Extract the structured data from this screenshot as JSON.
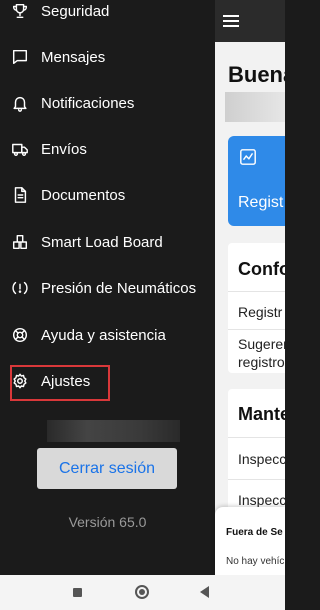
{
  "drawer": {
    "items": [
      {
        "label": "Seguridad",
        "icon": "trophy-icon"
      },
      {
        "label": "Mensajes",
        "icon": "message-icon"
      },
      {
        "label": "Notificaciones",
        "icon": "bell-icon"
      },
      {
        "label": "Envíos",
        "icon": "truck-icon"
      },
      {
        "label": "Documentos",
        "icon": "document-icon"
      },
      {
        "label": "Smart Load Board",
        "icon": "load-board-icon"
      },
      {
        "label": "Presión de Neumáticos",
        "icon": "tire-pressure-icon"
      },
      {
        "label": "Ayuda y asistencia",
        "icon": "lifebuoy-icon"
      },
      {
        "label": "Ajustes",
        "icon": "gear-icon"
      }
    ],
    "logout_label": "Cerrar sesión",
    "version": "Versión 65.0"
  },
  "main": {
    "greeting": "Buena",
    "register_card": {
      "label": "Regist",
      "icon": "chart-icon"
    },
    "card1": {
      "title": "Confo",
      "rows": [
        "Registr",
        "Sugeren",
        "registro"
      ]
    },
    "card2": {
      "title": "Mante",
      "rows": [
        "Inspecc",
        "Inspecc"
      ]
    },
    "bottom_sheet": {
      "title": "Fuera de Se",
      "text": "No hay vehíc"
    }
  },
  "colors": {
    "accent": "#1a73e8",
    "highlight": "#d9383a",
    "card_blue": "#2f8ae8"
  }
}
